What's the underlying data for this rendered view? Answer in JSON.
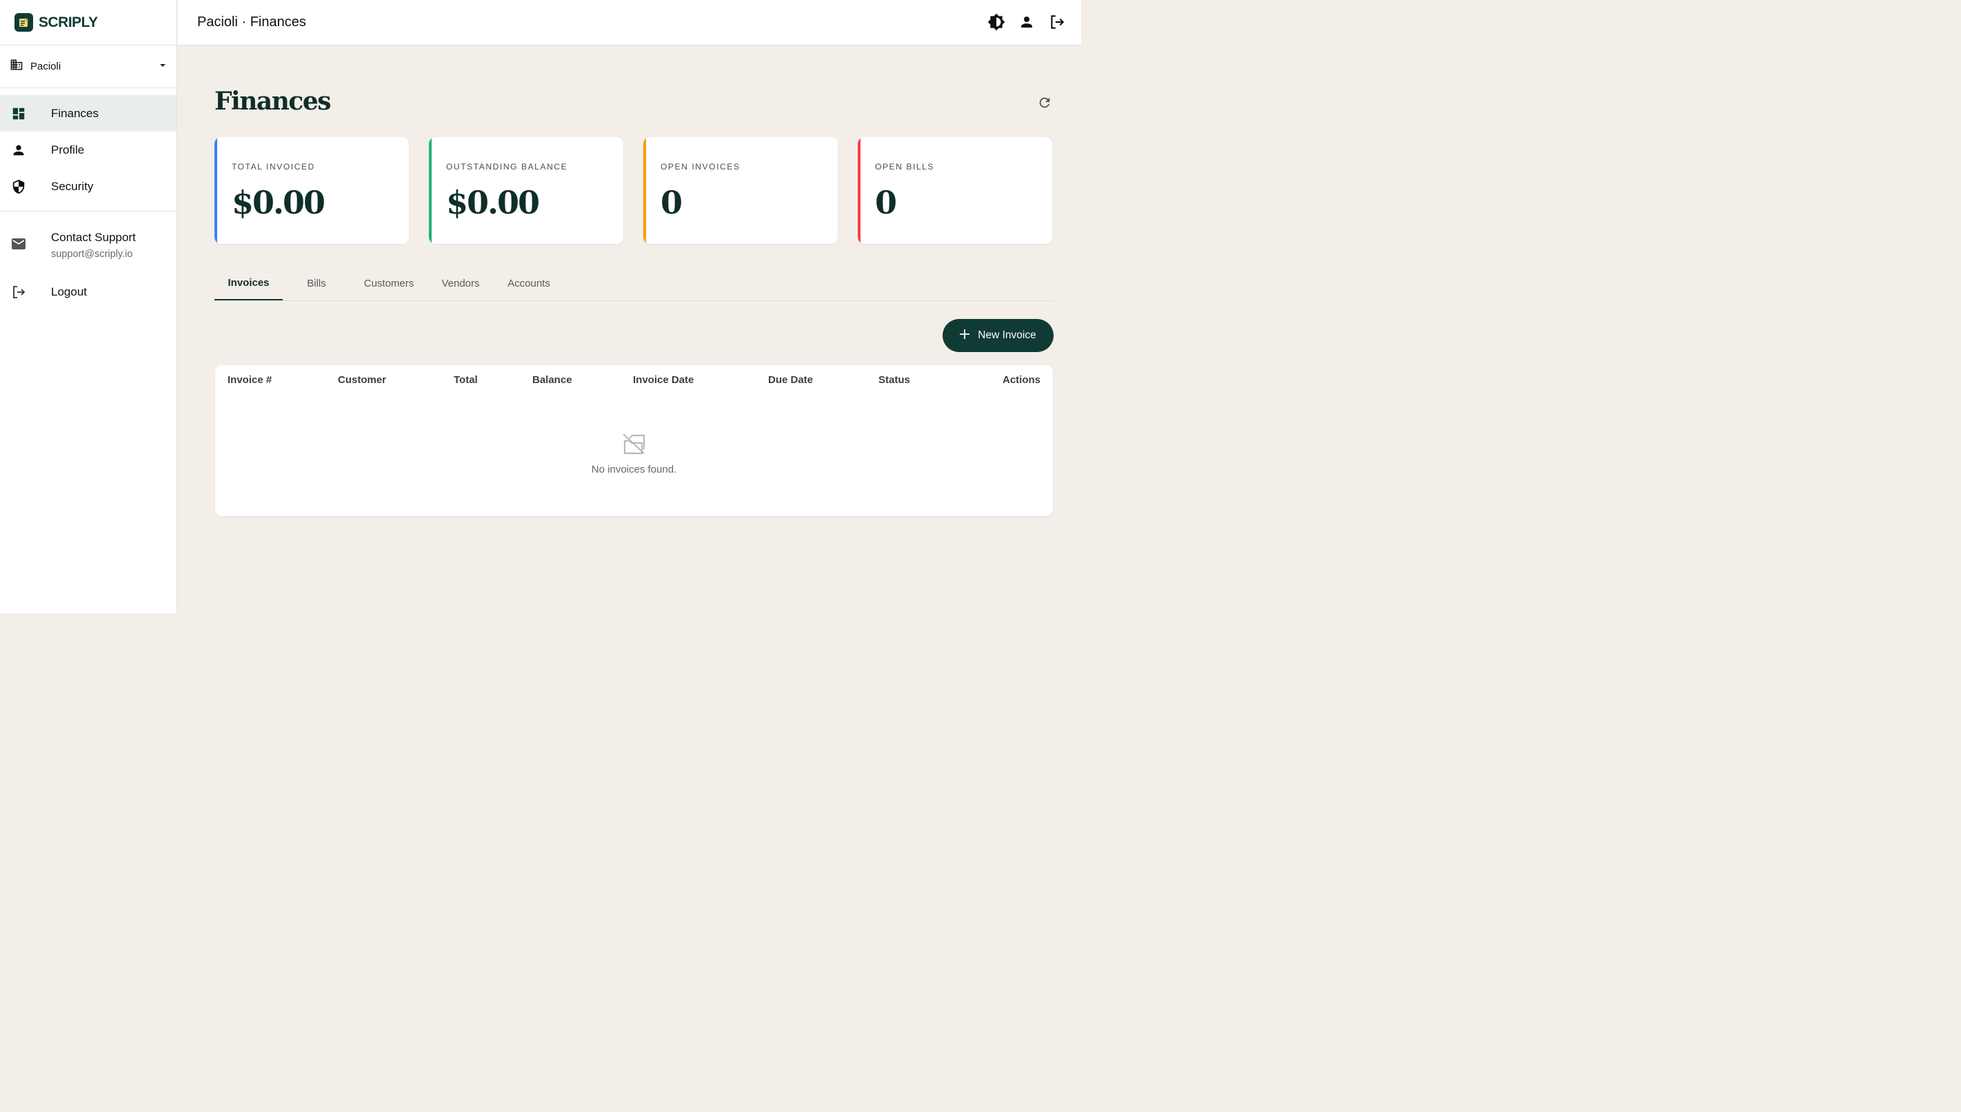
{
  "brand": {
    "name": "SCRIPLY",
    "logo_icon": "notepad-icon"
  },
  "organization": {
    "name": "Pacioli",
    "icon": "building-icon"
  },
  "sidebar": {
    "items": [
      {
        "label": "Finances",
        "icon": "dashboard-icon",
        "active": true
      },
      {
        "label": "Profile",
        "icon": "person-icon",
        "active": false
      },
      {
        "label": "Security",
        "icon": "shield-icon",
        "active": false
      }
    ],
    "support": {
      "title": "Contact Support",
      "email": "support@scriply.io",
      "icon": "mail-icon"
    },
    "logout": {
      "label": "Logout",
      "icon": "logout-icon"
    }
  },
  "topbar": {
    "breadcrumb": "Pacioli · Finances",
    "actions": [
      "theme-toggle-icon",
      "account-icon",
      "logout-icon"
    ]
  },
  "page": {
    "title": "Finances"
  },
  "stats": [
    {
      "label": "TOTAL INVOICED",
      "value": "$0.00",
      "accent": "#3b82f6"
    },
    {
      "label": "OUTSTANDING BALANCE",
      "value": "$0.00",
      "accent": "#22b07d"
    },
    {
      "label": "OPEN INVOICES",
      "value": "0",
      "accent": "#f59e0b"
    },
    {
      "label": "OPEN BILLS",
      "value": "0",
      "accent": "#ef4444"
    }
  ],
  "tabs": [
    {
      "label": "Invoices",
      "active": true
    },
    {
      "label": "Bills",
      "active": false
    },
    {
      "label": "Customers",
      "active": false
    },
    {
      "label": "Vendors",
      "active": false
    },
    {
      "label": "Accounts",
      "active": false
    }
  ],
  "actions": {
    "new_invoice_label": "New Invoice"
  },
  "table": {
    "columns": [
      "Invoice #",
      "Customer",
      "Total",
      "Balance",
      "Invoice Date",
      "Due Date",
      "Status",
      "Actions"
    ],
    "rows": [],
    "empty_message": "No invoices found."
  },
  "colors": {
    "primary": "#0f3b34",
    "background": "#f3eee8",
    "active_nav": "#e9eeec"
  }
}
